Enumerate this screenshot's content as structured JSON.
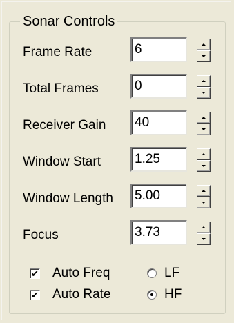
{
  "group": {
    "title": "Sonar Controls"
  },
  "fields": [
    {
      "label": "Frame Rate",
      "value": "6"
    },
    {
      "label": "Total Frames",
      "value": "0"
    },
    {
      "label": "Receiver Gain",
      "value": "40"
    },
    {
      "label": "Window Start",
      "value": "1.25"
    },
    {
      "label": "Window Length",
      "value": "5.00"
    },
    {
      "label": "Focus",
      "value": "3.73"
    }
  ],
  "options": {
    "auto_freq": {
      "label": "Auto Freq",
      "checked": true
    },
    "auto_rate": {
      "label": "Auto Rate",
      "checked": true
    },
    "lf": {
      "label": "LF",
      "selected": false
    },
    "hf": {
      "label": "HF",
      "selected": true
    }
  },
  "icons": {
    "spin_up": "up-arrow-icon",
    "spin_down": "down-arrow-icon",
    "check": "checkmark-icon"
  }
}
